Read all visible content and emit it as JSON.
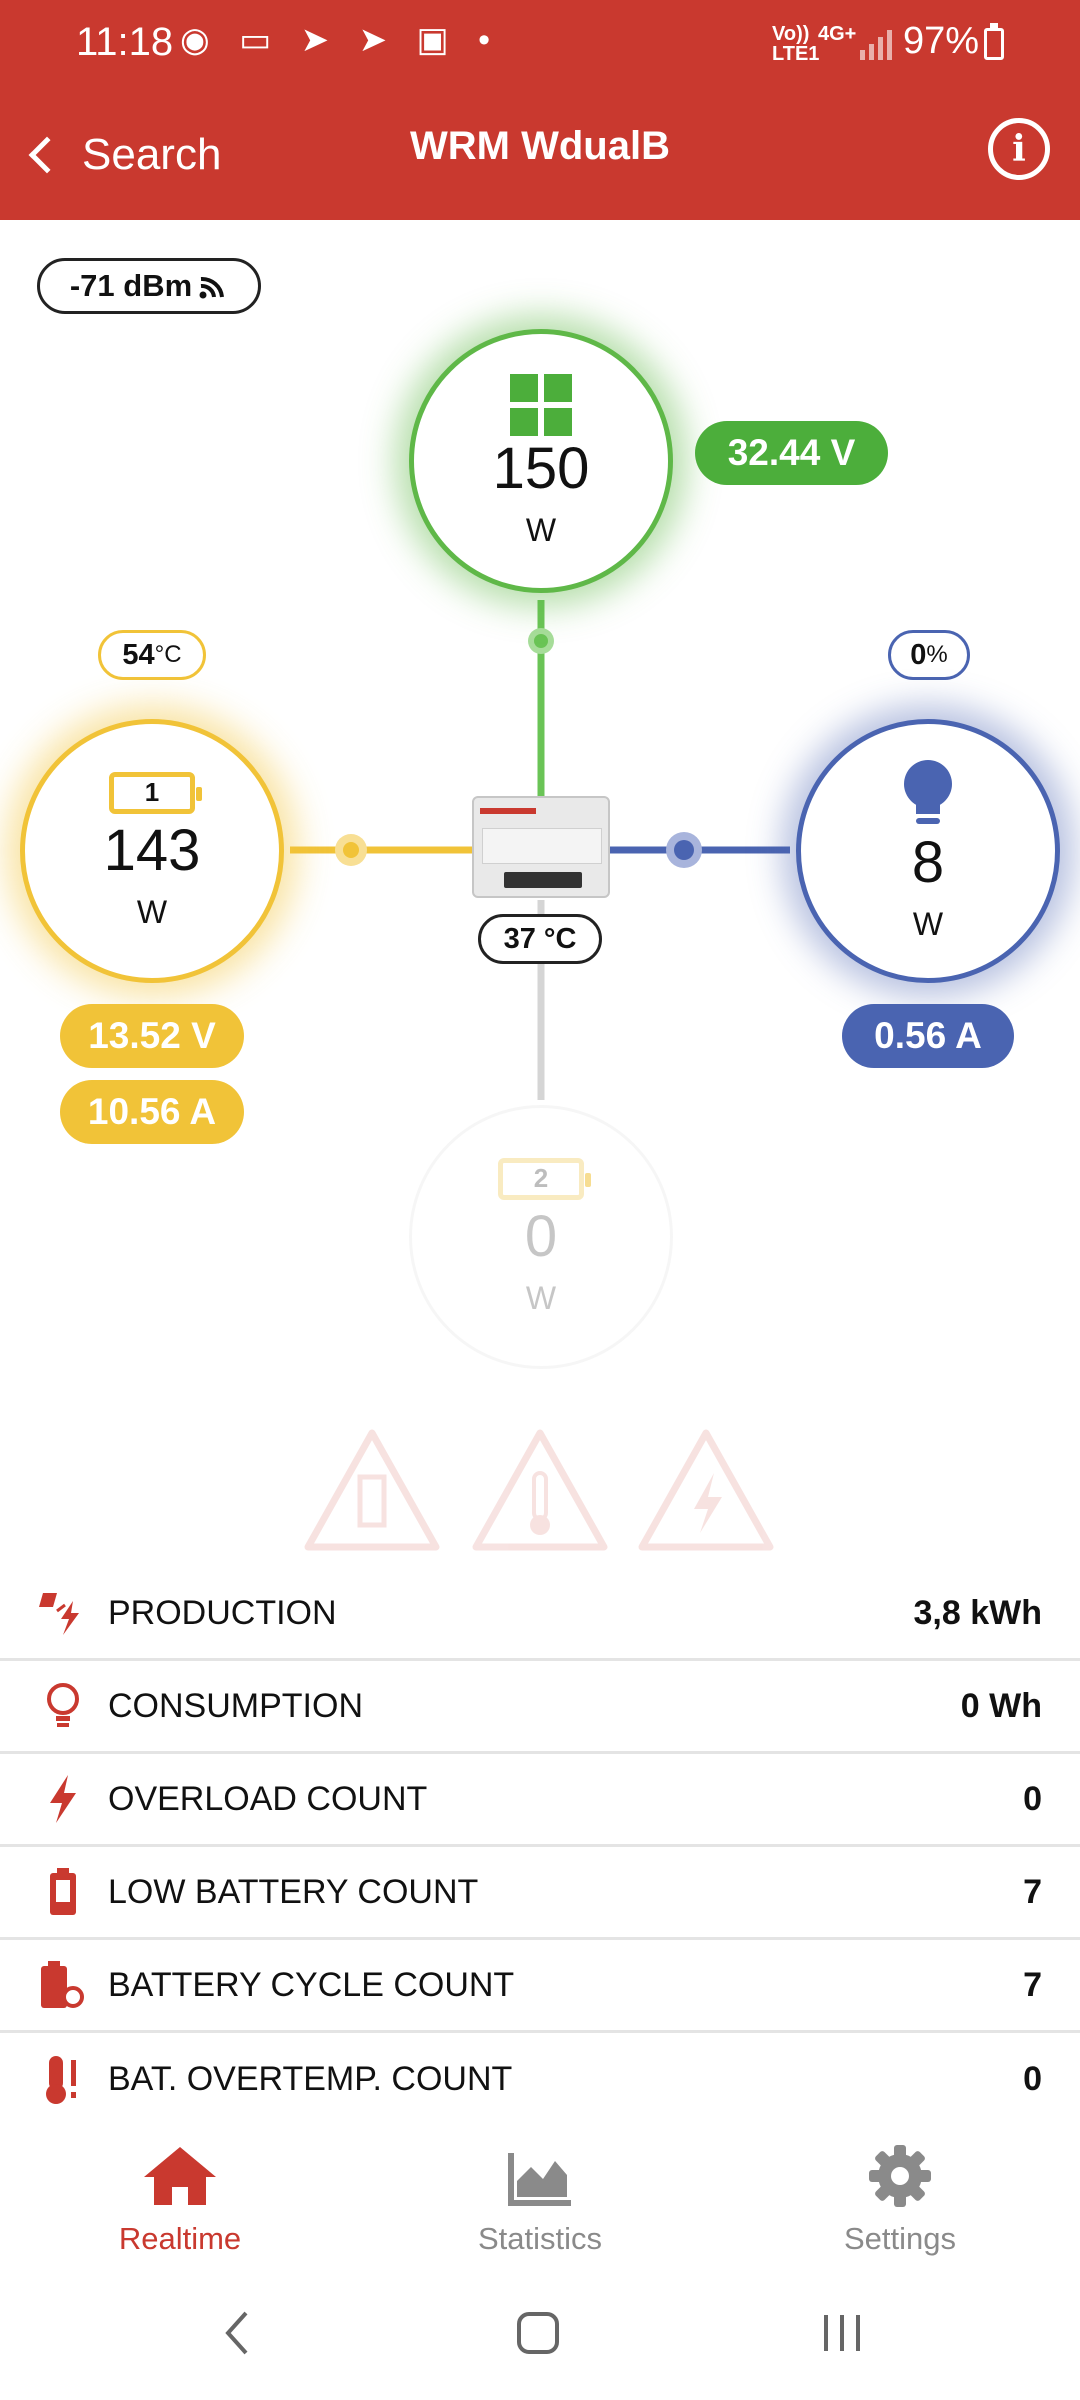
{
  "status_bar": {
    "time": "11:18",
    "network_top": "Vo))",
    "network_bottom": "LTE1",
    "network_type": "4G+",
    "battery": "97%"
  },
  "header": {
    "back_label": "Search",
    "title": "WRM WdualB",
    "info_icon": "info-icon"
  },
  "signal": {
    "label": "-71 dBm"
  },
  "solar": {
    "value": "150",
    "unit": "W",
    "voltage": "32.44 V",
    "color": "#4cae3b"
  },
  "battery1": {
    "badge": "1",
    "temp_value": "54",
    "temp_unit": "°C",
    "value": "143",
    "unit": "W",
    "voltage": "13.52 V",
    "current": "10.56 A",
    "color": "#f1c338"
  },
  "load": {
    "percent_value": "0",
    "percent_unit": "%",
    "value": "8",
    "unit": "W",
    "current": "0.56 A",
    "color": "#4a64b1"
  },
  "controller": {
    "temp": "37 °C"
  },
  "battery2": {
    "badge": "2",
    "value": "0",
    "unit": "W"
  },
  "warnings": [
    "battery-warning-icon",
    "thermometer-warning-icon",
    "lightning-warning-icon"
  ],
  "stats": [
    {
      "label": "PRODUCTION",
      "value": "3,8 kWh",
      "icon": "production-icon"
    },
    {
      "label": "CONSUMPTION",
      "value": "0 Wh",
      "icon": "lightbulb-icon"
    },
    {
      "label": "OVERLOAD COUNT",
      "value": "0",
      "icon": "lightning-icon"
    },
    {
      "label": "LOW BATTERY COUNT",
      "value": "7",
      "icon": "battery-low-icon"
    },
    {
      "label": "BATTERY CYCLE COUNT",
      "value": "7",
      "icon": "battery-cycle-icon"
    },
    {
      "label": "BAT. OVERTEMP. COUNT",
      "value": "0",
      "icon": "battery-overtemp-icon"
    }
  ],
  "tabs": [
    {
      "label": "Realtime",
      "icon": "home-icon",
      "active": true
    },
    {
      "label": "Statistics",
      "icon": "chart-icon",
      "active": false
    },
    {
      "label": "Settings",
      "icon": "gear-icon",
      "active": false
    }
  ],
  "colors": {
    "accent": "#c9392f",
    "inactive": "#8a8a8a"
  }
}
